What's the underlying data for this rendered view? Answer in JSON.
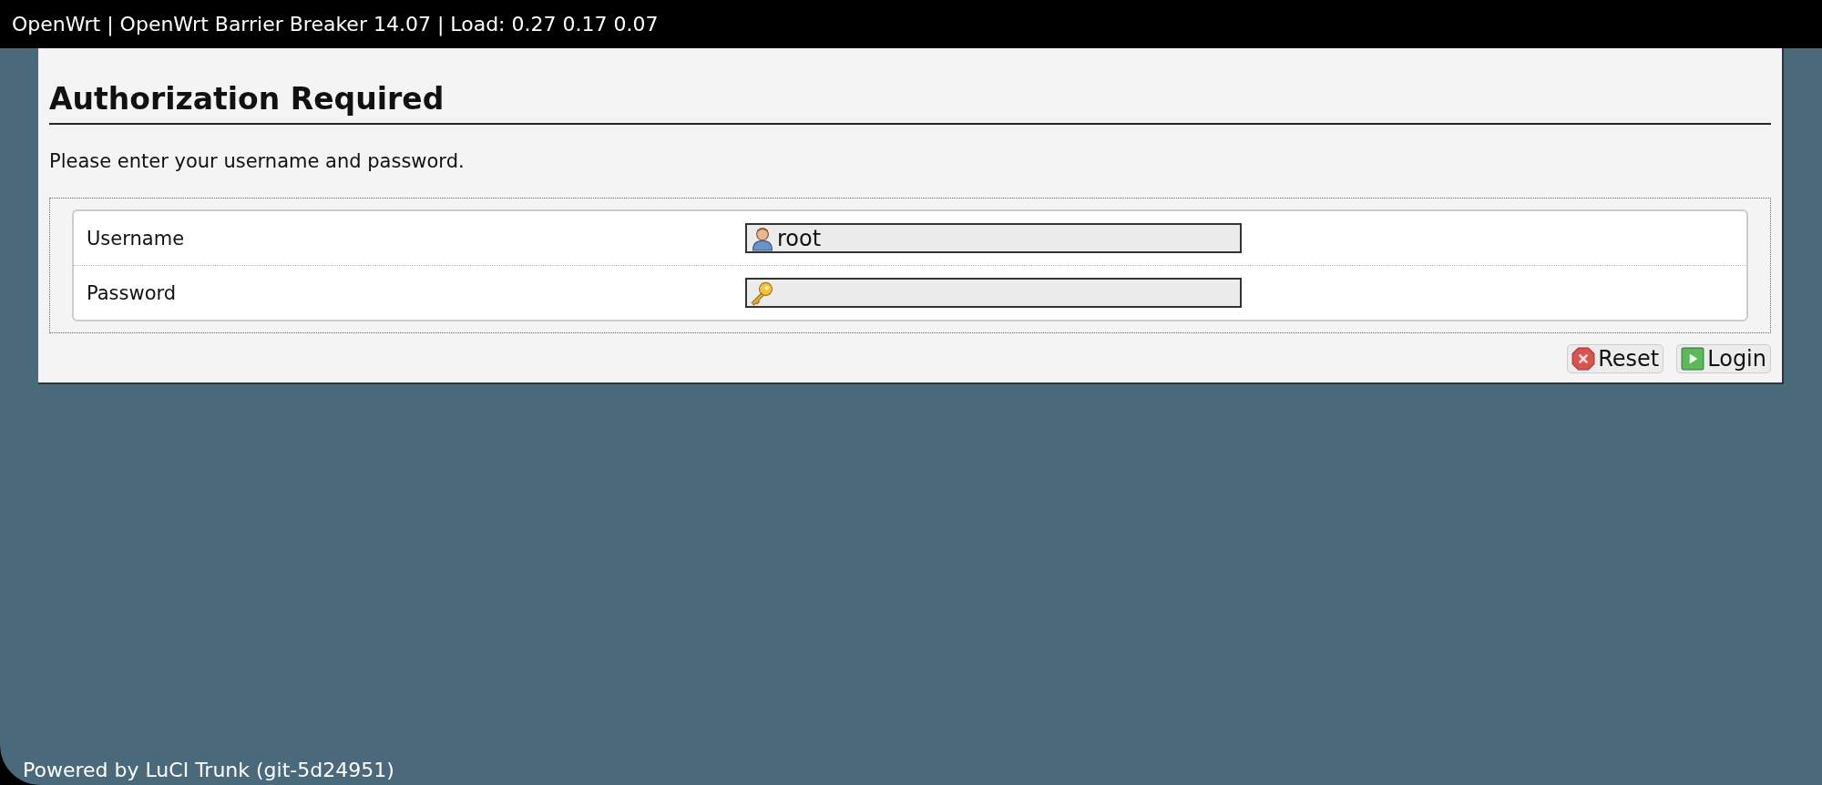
{
  "header": {
    "title": "OpenWrt | OpenWrt Barrier Breaker 14.07 | Load: 0.27 0.17 0.07"
  },
  "heading": "Authorization Required",
  "intro": "Please enter your username and password.",
  "fields": [
    {
      "label": "Username",
      "kind": "user",
      "value": "root"
    },
    {
      "label": "Password",
      "kind": "password"
    }
  ],
  "buttons": [
    {
      "label": "Reset",
      "kind": "reset"
    },
    {
      "label": "Login",
      "kind": "login"
    }
  ],
  "footer": "Powered by LuCI Trunk (git-5d24951)"
}
